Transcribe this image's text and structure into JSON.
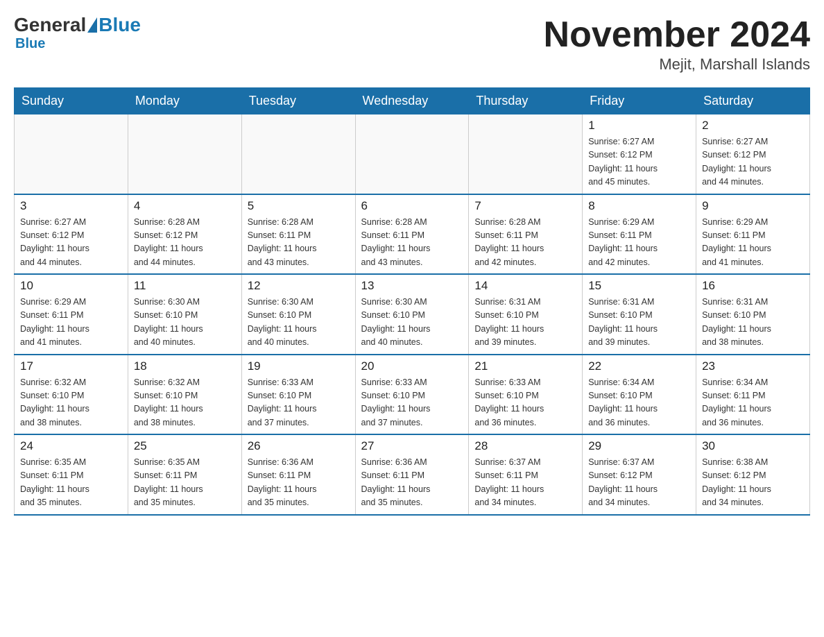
{
  "header": {
    "logo": {
      "part1": "General",
      "part2": "Blue"
    },
    "title": "November 2024",
    "location": "Mejit, Marshall Islands"
  },
  "weekdays": [
    "Sunday",
    "Monday",
    "Tuesday",
    "Wednesday",
    "Thursday",
    "Friday",
    "Saturday"
  ],
  "weeks": [
    [
      {
        "day": "",
        "info": ""
      },
      {
        "day": "",
        "info": ""
      },
      {
        "day": "",
        "info": ""
      },
      {
        "day": "",
        "info": ""
      },
      {
        "day": "",
        "info": ""
      },
      {
        "day": "1",
        "info": "Sunrise: 6:27 AM\nSunset: 6:12 PM\nDaylight: 11 hours\nand 45 minutes."
      },
      {
        "day": "2",
        "info": "Sunrise: 6:27 AM\nSunset: 6:12 PM\nDaylight: 11 hours\nand 44 minutes."
      }
    ],
    [
      {
        "day": "3",
        "info": "Sunrise: 6:27 AM\nSunset: 6:12 PM\nDaylight: 11 hours\nand 44 minutes."
      },
      {
        "day": "4",
        "info": "Sunrise: 6:28 AM\nSunset: 6:12 PM\nDaylight: 11 hours\nand 44 minutes."
      },
      {
        "day": "5",
        "info": "Sunrise: 6:28 AM\nSunset: 6:11 PM\nDaylight: 11 hours\nand 43 minutes."
      },
      {
        "day": "6",
        "info": "Sunrise: 6:28 AM\nSunset: 6:11 PM\nDaylight: 11 hours\nand 43 minutes."
      },
      {
        "day": "7",
        "info": "Sunrise: 6:28 AM\nSunset: 6:11 PM\nDaylight: 11 hours\nand 42 minutes."
      },
      {
        "day": "8",
        "info": "Sunrise: 6:29 AM\nSunset: 6:11 PM\nDaylight: 11 hours\nand 42 minutes."
      },
      {
        "day": "9",
        "info": "Sunrise: 6:29 AM\nSunset: 6:11 PM\nDaylight: 11 hours\nand 41 minutes."
      }
    ],
    [
      {
        "day": "10",
        "info": "Sunrise: 6:29 AM\nSunset: 6:11 PM\nDaylight: 11 hours\nand 41 minutes."
      },
      {
        "day": "11",
        "info": "Sunrise: 6:30 AM\nSunset: 6:10 PM\nDaylight: 11 hours\nand 40 minutes."
      },
      {
        "day": "12",
        "info": "Sunrise: 6:30 AM\nSunset: 6:10 PM\nDaylight: 11 hours\nand 40 minutes."
      },
      {
        "day": "13",
        "info": "Sunrise: 6:30 AM\nSunset: 6:10 PM\nDaylight: 11 hours\nand 40 minutes."
      },
      {
        "day": "14",
        "info": "Sunrise: 6:31 AM\nSunset: 6:10 PM\nDaylight: 11 hours\nand 39 minutes."
      },
      {
        "day": "15",
        "info": "Sunrise: 6:31 AM\nSunset: 6:10 PM\nDaylight: 11 hours\nand 39 minutes."
      },
      {
        "day": "16",
        "info": "Sunrise: 6:31 AM\nSunset: 6:10 PM\nDaylight: 11 hours\nand 38 minutes."
      }
    ],
    [
      {
        "day": "17",
        "info": "Sunrise: 6:32 AM\nSunset: 6:10 PM\nDaylight: 11 hours\nand 38 minutes."
      },
      {
        "day": "18",
        "info": "Sunrise: 6:32 AM\nSunset: 6:10 PM\nDaylight: 11 hours\nand 38 minutes."
      },
      {
        "day": "19",
        "info": "Sunrise: 6:33 AM\nSunset: 6:10 PM\nDaylight: 11 hours\nand 37 minutes."
      },
      {
        "day": "20",
        "info": "Sunrise: 6:33 AM\nSunset: 6:10 PM\nDaylight: 11 hours\nand 37 minutes."
      },
      {
        "day": "21",
        "info": "Sunrise: 6:33 AM\nSunset: 6:10 PM\nDaylight: 11 hours\nand 36 minutes."
      },
      {
        "day": "22",
        "info": "Sunrise: 6:34 AM\nSunset: 6:10 PM\nDaylight: 11 hours\nand 36 minutes."
      },
      {
        "day": "23",
        "info": "Sunrise: 6:34 AM\nSunset: 6:11 PM\nDaylight: 11 hours\nand 36 minutes."
      }
    ],
    [
      {
        "day": "24",
        "info": "Sunrise: 6:35 AM\nSunset: 6:11 PM\nDaylight: 11 hours\nand 35 minutes."
      },
      {
        "day": "25",
        "info": "Sunrise: 6:35 AM\nSunset: 6:11 PM\nDaylight: 11 hours\nand 35 minutes."
      },
      {
        "day": "26",
        "info": "Sunrise: 6:36 AM\nSunset: 6:11 PM\nDaylight: 11 hours\nand 35 minutes."
      },
      {
        "day": "27",
        "info": "Sunrise: 6:36 AM\nSunset: 6:11 PM\nDaylight: 11 hours\nand 35 minutes."
      },
      {
        "day": "28",
        "info": "Sunrise: 6:37 AM\nSunset: 6:11 PM\nDaylight: 11 hours\nand 34 minutes."
      },
      {
        "day": "29",
        "info": "Sunrise: 6:37 AM\nSunset: 6:12 PM\nDaylight: 11 hours\nand 34 minutes."
      },
      {
        "day": "30",
        "info": "Sunrise: 6:38 AM\nSunset: 6:12 PM\nDaylight: 11 hours\nand 34 minutes."
      }
    ]
  ]
}
